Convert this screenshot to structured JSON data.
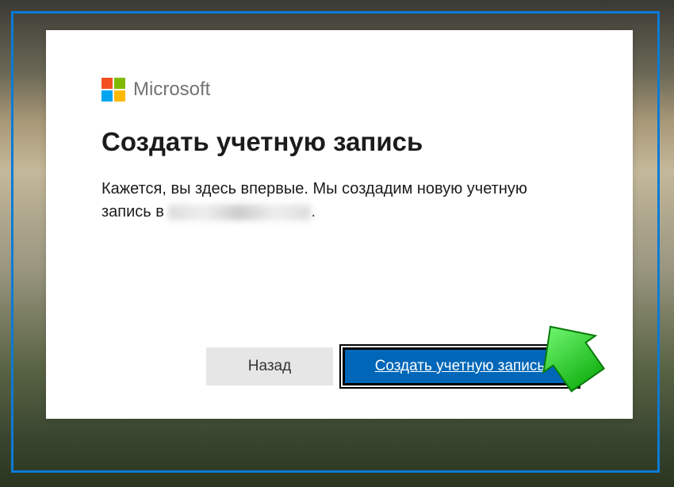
{
  "brand": {
    "name": "Microsoft"
  },
  "dialog": {
    "title": "Создать учетную запись",
    "body_text": "Кажется, вы здесь впервые. Мы создадим новую учетную запись в ",
    "redacted_email": "(скрыто)"
  },
  "buttons": {
    "back": "Назад",
    "create": "Создать учетную запись"
  },
  "annotation": {
    "arrow_color": "#2dd62d"
  }
}
